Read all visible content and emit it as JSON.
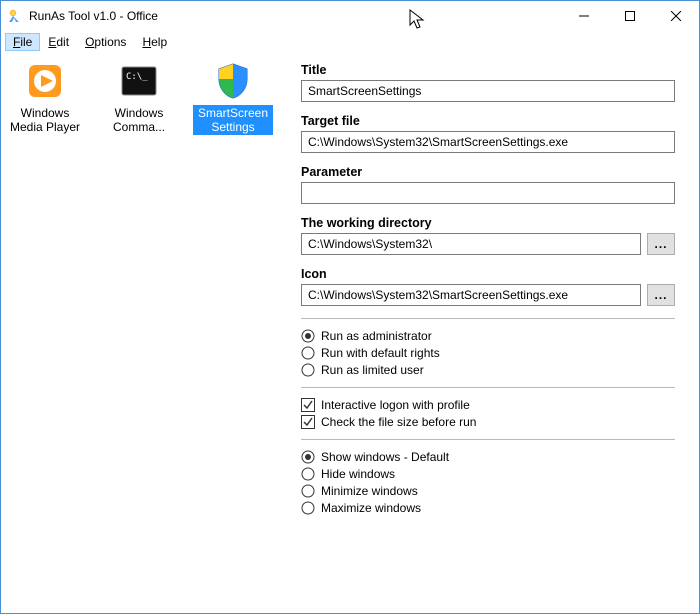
{
  "window": {
    "title": "RunAs Tool v1.0 - Office"
  },
  "menu": {
    "file": "File",
    "edit": "Edit",
    "options": "Options",
    "help": "Help"
  },
  "launchers": {
    "wmp": "Windows Media Player",
    "cmd": "Windows Comma...",
    "sss": "SmartScreenSettings"
  },
  "form": {
    "title_label": "Title",
    "title_value": "SmartScreenSettings",
    "target_label": "Target file",
    "target_value": "C:\\Windows\\System32\\SmartScreenSettings.exe",
    "param_label": "Parameter",
    "param_value": "",
    "workdir_label": "The working directory",
    "workdir_value": "C:\\Windows\\System32\\",
    "icon_label": "Icon",
    "icon_value": "C:\\Windows\\System32\\SmartScreenSettings.exe",
    "browse_label": "..."
  },
  "runMode": {
    "admin": "Run as administrator",
    "default": "Run with default rights",
    "limited": "Run as limited user"
  },
  "checks": {
    "interactive": "Interactive logon with profile",
    "checksize": "Check the file size before run"
  },
  "winMode": {
    "show": "Show windows - Default",
    "hide": "Hide windows",
    "min": "Minimize windows",
    "max": "Maximize windows"
  }
}
